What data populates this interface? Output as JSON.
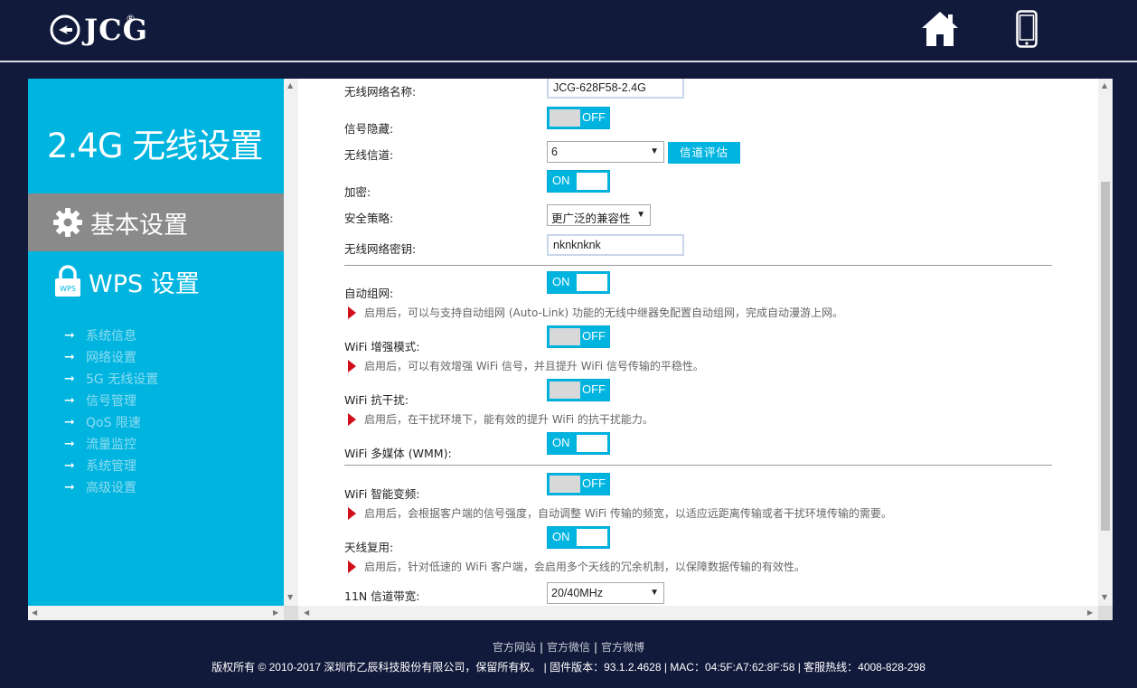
{
  "brand": {
    "name": "JCG",
    "reg": "®"
  },
  "sidebar": {
    "title": "2.4G 无线设置",
    "active_item": "基本设置",
    "wps_item": "WPS 设置",
    "links": [
      "系统信息",
      "网络设置",
      "5G 无线设置",
      "信号管理",
      "QoS 限速",
      "流量监控",
      "系统管理",
      "高级设置"
    ]
  },
  "form": {
    "ssid": {
      "label": "无线网络名称:",
      "value": "JCG-628F58-2.4G"
    },
    "hide_ssid": {
      "label": "信号隐藏:",
      "state": "OFF"
    },
    "channel": {
      "label": "无线信道:",
      "value": "6",
      "eval_button": "信道评估"
    },
    "encryption": {
      "label": "加密:",
      "state": "ON"
    },
    "security": {
      "label": "安全策略:",
      "value": "更广泛的兼容性"
    },
    "key": {
      "label": "无线网络密钥:",
      "value": "nknknknk"
    },
    "auto_mesh": {
      "label": "自动组网:",
      "state": "ON",
      "note": "启用后，可以与支持自动组网 (Auto-Link) 功能的无线中继器免配置自动组网，完成自动漫游上网。"
    },
    "wifi_boost": {
      "label": "WiFi 增强模式:",
      "state": "OFF",
      "note": "启用后，可以有效增强 WiFi 信号，并且提升 WiFi 信号传输的平稳性。"
    },
    "anti_interference": {
      "label": "WiFi 抗干扰:",
      "state": "OFF",
      "note": "启用后，在干扰环境下，能有效的提升 WiFi 的抗干扰能力。"
    },
    "wmm": {
      "label": "WiFi 多媒体 (WMM):",
      "state": "ON"
    },
    "smart_bandwidth": {
      "label": "WiFi 智能变频:",
      "state": "OFF",
      "note": "启用后，会根据客户端的信号强度，自动调整 WiFi 传输的频宽，以适应远距离传输或者干扰环境传输的需要。"
    },
    "antenna_reuse": {
      "label": "天线复用:",
      "state": "ON",
      "note": "启用后，针对低速的 WiFi 客户端，会启用多个天线的冗余机制，以保障数据传输的有效性。"
    },
    "bandwidth_11n": {
      "label": "11N 信道带宽:",
      "value": "20/40MHz"
    }
  },
  "footer": {
    "links": [
      "官方网站",
      "官方微信",
      "官方微博"
    ],
    "copyright": "版权所有 © 2010-2017 深圳市乙辰科技股份有限公司，保留所有权。 | 固件版本：93.1.2.4628 | MAC：04:5F:A7:62:8F:58 | 客服热线：4008-828-298"
  },
  "colors": {
    "header_bg": "#121a3b",
    "accent": "#00b4e0",
    "active_nav": "#8a8a8a",
    "note_marker": "#d10f1b"
  },
  "icons": {
    "home": "home-icon",
    "phone": "mobile-phone-icon",
    "gear": "gear-icon",
    "lock": "wps-lock-icon"
  }
}
